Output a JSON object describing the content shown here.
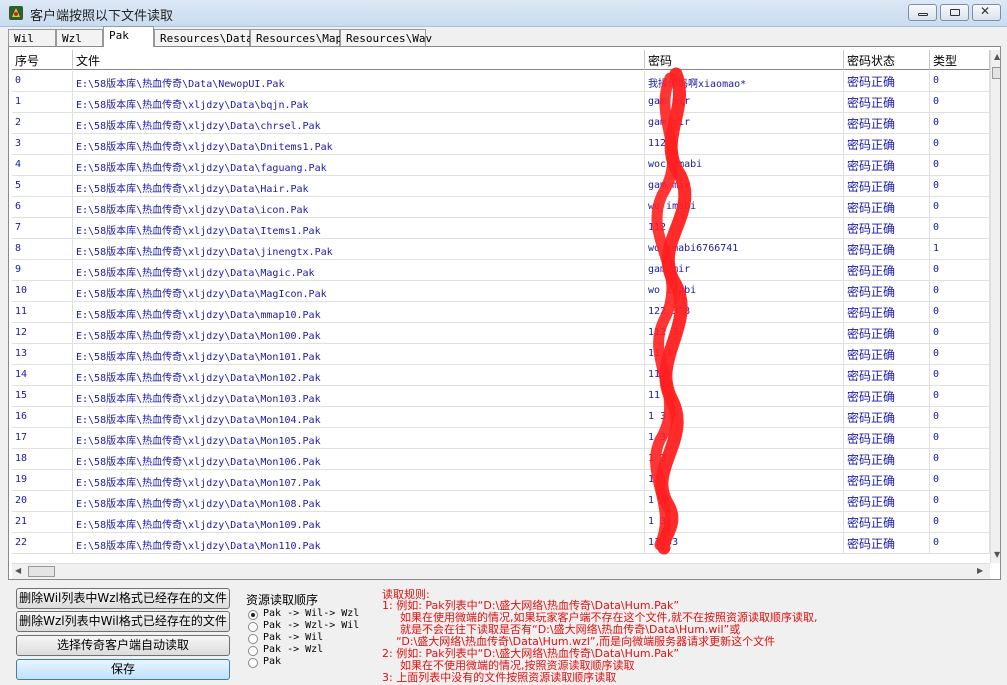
{
  "window": {
    "title": "客户端按照以下文件读取"
  },
  "tabs": [
    "Wil",
    "Wzl",
    "Pak",
    "Resources\\Data",
    "Resources\\Map",
    "Resources\\Wav"
  ],
  "active_tab": 2,
  "columns": [
    "序号",
    "文件",
    "密码",
    "密码状态",
    "类型"
  ],
  "rows": [
    {
      "idx": "0",
      "file": "E:\\58版本库\\热血传奇\\Data\\NewopUI.Pak",
      "pwd": "我操你妈啊xiaomao*",
      "status": "密码正确",
      "type": "0"
    },
    {
      "idx": "1",
      "file": "E:\\58版本库\\热血传奇\\xljdzy\\Data\\bqjn.Pak",
      "pwd": "gam  mir",
      "status": "密码正确",
      "type": "0"
    },
    {
      "idx": "2",
      "file": "E:\\58版本库\\热血传奇\\xljdzy\\Data\\chrsel.Pak",
      "pwd": "gam  mir",
      "status": "密码正确",
      "type": "0"
    },
    {
      "idx": "3",
      "file": "E:\\58版本库\\热血传奇\\xljdzy\\Data\\Dnitems1.Pak",
      "pwd": "112",
      "status": "密码正确",
      "type": "0"
    },
    {
      "idx": "4",
      "file": "E:\\58版本库\\热血传奇\\xljdzy\\Data\\faguang.Pak",
      "pwd": "woc  imabi",
      "status": "密码正确",
      "type": "0"
    },
    {
      "idx": "5",
      "file": "E:\\58版本库\\热血传奇\\xljdzy\\Data\\Hair.Pak",
      "pwd": "gam  mir",
      "status": "密码正确",
      "type": "0"
    },
    {
      "idx": "6",
      "file": "E:\\58版本库\\热血传奇\\xljdzy\\Data\\icon.Pak",
      "pwd": "wo  imabi",
      "status": "密码正确",
      "type": "0"
    },
    {
      "idx": "7",
      "file": "E:\\58版本库\\热血传奇\\xljdzy\\Data\\Items1.Pak",
      "pwd": "112",
      "status": "密码正确",
      "type": "0"
    },
    {
      "idx": "8",
      "file": "E:\\58版本库\\热血传奇\\xljdzy\\Data\\jinengtx.Pak",
      "pwd": "wo  imabi6766741",
      "status": "密码正确",
      "type": "1"
    },
    {
      "idx": "9",
      "file": "E:\\58版本库\\热血传奇\\xljdzy\\Data\\Magic.Pak",
      "pwd": "gam  mir",
      "status": "密码正确",
      "type": "0"
    },
    {
      "idx": "10",
      "file": "E:\\58版本库\\热血传奇\\xljdzy\\Data\\MagIcon.Pak",
      "pwd": "wo  imabi",
      "status": "密码正确",
      "type": "0"
    },
    {
      "idx": "11",
      "file": "E:\\58版本库\\热血传奇\\xljdzy\\Data\\mmap10.Pak",
      "pwd": "122  378",
      "status": "密码正确",
      "type": "0"
    },
    {
      "idx": "12",
      "file": "E:\\58版本库\\热血传奇\\xljdzy\\Data\\Mon100.Pak",
      "pwd": "112  3",
      "status": "密码正确",
      "type": "0"
    },
    {
      "idx": "13",
      "file": "E:\\58版本库\\热血传奇\\xljdzy\\Data\\Mon101.Pak",
      "pwd": "11  3",
      "status": "密码正确",
      "type": "0"
    },
    {
      "idx": "14",
      "file": "E:\\58版本库\\热血传奇\\xljdzy\\Data\\Mon102.Pak",
      "pwd": "11  3",
      "status": "密码正确",
      "type": "0"
    },
    {
      "idx": "15",
      "file": "E:\\58版本库\\热血传奇\\xljdzy\\Data\\Mon103.Pak",
      "pwd": "11  3",
      "status": "密码正确",
      "type": "0"
    },
    {
      "idx": "16",
      "file": "E:\\58版本库\\热血传奇\\xljdzy\\Data\\Mon104.Pak",
      "pwd": "1  3",
      "status": "密码正确",
      "type": "0"
    },
    {
      "idx": "17",
      "file": "E:\\58版本库\\热血传奇\\xljdzy\\Data\\Mon105.Pak",
      "pwd": "1  3",
      "status": "密码正确",
      "type": "0"
    },
    {
      "idx": "18",
      "file": "E:\\58版本库\\热血传奇\\xljdzy\\Data\\Mon106.Pak",
      "pwd": "1  3",
      "status": "密码正确",
      "type": "0"
    },
    {
      "idx": "19",
      "file": "E:\\58版本库\\热血传奇\\xljdzy\\Data\\Mon107.Pak",
      "pwd": "1  3",
      "status": "密码正确",
      "type": "0"
    },
    {
      "idx": "20",
      "file": "E:\\58版本库\\热血传奇\\xljdzy\\Data\\Mon108.Pak",
      "pwd": "1  3",
      "status": "密码正确",
      "type": "0"
    },
    {
      "idx": "21",
      "file": "E:\\58版本库\\热血传奇\\xljdzy\\Data\\Mon109.Pak",
      "pwd": "1  3",
      "status": "密码正确",
      "type": "0"
    },
    {
      "idx": "22",
      "file": "E:\\58版本库\\热血传奇\\xljdzy\\Data\\Mon110.Pak",
      "pwd": "11  33",
      "status": "密码正确",
      "type": "0"
    }
  ],
  "buttons": {
    "delete_wzl": "删除Wil列表中Wzl格式已经存在的文件",
    "delete_wil": "删除Wzl列表中Wil格式已经存在的文件",
    "select_client": "选择传奇客户端自动读取",
    "save": "保存"
  },
  "read_order": {
    "label": "资源读取顺序",
    "options": [
      "Pak -> Wil-> Wzl",
      "Pak -> Wzl-> Wil",
      "Pak -> Wil",
      "Pak -> Wzl",
      "Pak"
    ],
    "selected": 0
  },
  "rules": {
    "title": "读取规则:",
    "lines": [
      "1: 例如: Pak列表中“D:\\盛大网络\\热血传奇\\Data\\Hum.Pak”",
      "如果在使用微端的情况,如果玩家客户端不存在这个文件,就不在按照资源读取顺序读取,",
      "就是不会在往下读取是否有“D:\\盛大网络\\热血传奇\\Data\\Hum.wil”或",
      "“D:\\盛大网络\\热血传奇\\Data\\Hum.wzl”,而是向微端服务器请求更新这个文件",
      "2: 例如: Pak列表中“D:\\盛大网络\\热血传奇\\Data\\Hum.Pak”",
      "如果在不使用微端的情况,按照资源读取顺序读取",
      "3: 上面列表中没有的文件按照资源读取顺序读取"
    ]
  },
  "colors": {
    "cell_text": "#1a1aa8",
    "rules_text": "#e01010",
    "scribble": "#ff2020"
  }
}
